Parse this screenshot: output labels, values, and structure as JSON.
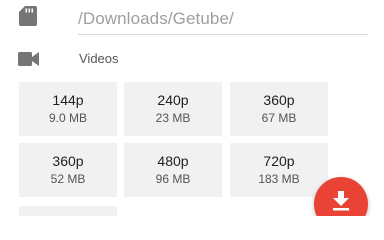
{
  "storage": {
    "icon": "sd-card-icon",
    "path": "/Downloads/Getube/"
  },
  "videos_section": {
    "icon": "video-camera-icon",
    "title": "Videos"
  },
  "formats": [
    {
      "resolution": "144p",
      "size": "9.0 MB"
    },
    {
      "resolution": "240p",
      "size": "23 MB"
    },
    {
      "resolution": "360p",
      "size": "67 MB"
    },
    {
      "resolution": "360p",
      "size": "52 MB"
    },
    {
      "resolution": "480p",
      "size": "96 MB"
    },
    {
      "resolution": "720p",
      "size": "183 MB"
    }
  ],
  "download_fab": {
    "icon": "download-icon",
    "color": "#e94335"
  },
  "colors": {
    "tile_background": "#f1f1f1",
    "path_text": "#9e9e9e",
    "icon_gray": "#757575"
  }
}
